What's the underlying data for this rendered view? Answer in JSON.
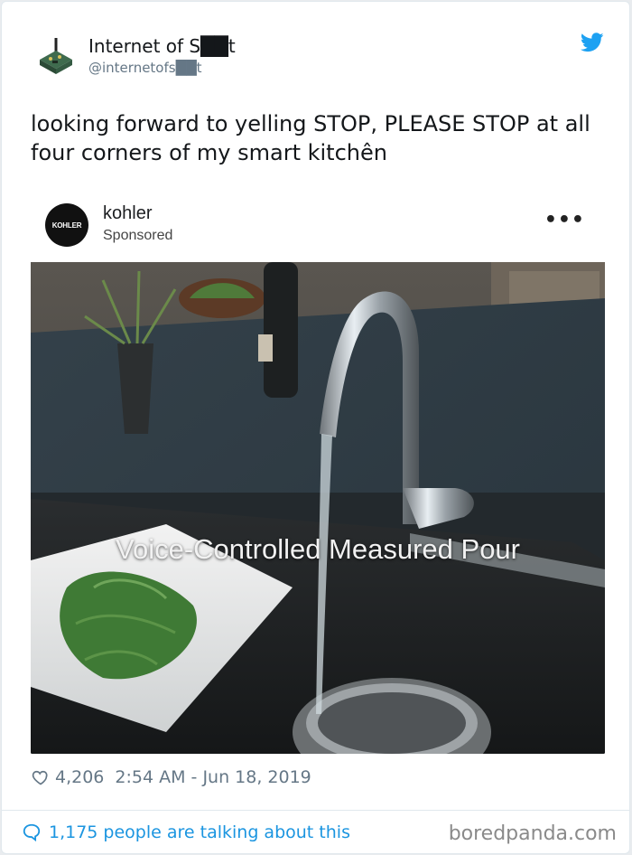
{
  "tweet": {
    "display_name": "Internet of S██t",
    "handle": "@internetofs██t",
    "text": "looking forward to yelling STOP, PLEASE STOP at all four corners of my smart kitchên",
    "likes": "4,206",
    "timestamp": "2:54 AM - Jun 18, 2019",
    "talking": "1,175 people are talking about this"
  },
  "ad": {
    "brand_logo_text": "KOHLER",
    "brand_name": "kohler",
    "sponsored_label": "Sponsored",
    "more_label": "•••",
    "video_caption": "Voice-Controlled Measured Pour"
  },
  "watermark": "boredpanda.com",
  "colors": {
    "link": "#1b95e0",
    "meta": "#657786",
    "text": "#14171a"
  },
  "icons": {
    "avatar": "robot-avatar-icon",
    "brand": "twitter-bird-icon",
    "like": "heart-icon",
    "reply": "speech-bubble-icon"
  }
}
